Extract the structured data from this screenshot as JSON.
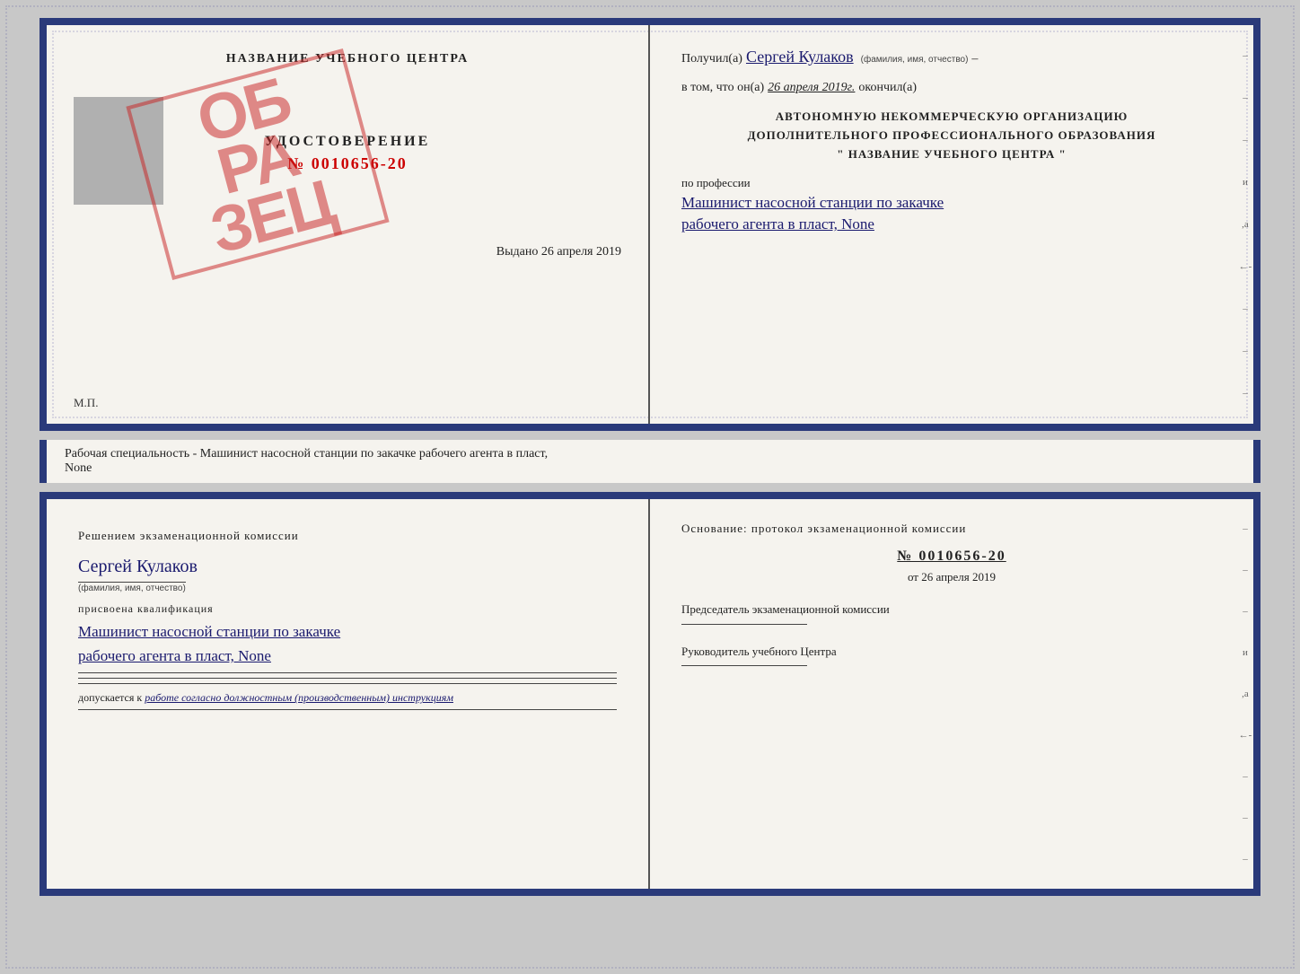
{
  "top_cert": {
    "left": {
      "title": "НАЗВАНИЕ УЧЕБНОГО ЦЕНТРА",
      "stamp_text": "ОБ\nРА\nЗЕЦ",
      "udost_label": "УДОСТОВЕРЕНИЕ",
      "udost_number": "№ 0010656-20",
      "vydano": "Выдано 26 апреля 2019",
      "mp": "М.П."
    },
    "right": {
      "poluchil_label": "Получил(а)",
      "poluchil_name": "Сергей Кулаков",
      "fio_label": "(фамилия, имя, отчество)",
      "vtom_label": "в том, что он(а)",
      "vtom_date": "26 апреля 2019г.",
      "okonchil": "окончил(а)",
      "org_line1": "АВТОНОМНУЮ НЕКОММЕРЧЕСКУЮ ОРГАНИЗАЦИЮ",
      "org_line2": "ДОПОЛНИТЕЛЬНОГО ПРОФЕССИОНАЛЬНОГО ОБРАЗОВАНИЯ",
      "org_line3": "\"   НАЗВАНИЕ УЧЕБНОГО ЦЕНТРА   \"",
      "po_professii": "по профессии",
      "profession_line1": "Машинист насосной станции по закачке",
      "profession_line2": "рабочего агента в пласт, None"
    }
  },
  "middle": {
    "text": "Рабочая специальность - Машинист насосной станции по закачке рабочего агента в пласт,",
    "text2": "None"
  },
  "bottom_cert": {
    "left": {
      "resheniem": "Решением экзаменационной комиссии",
      "name": "Сергей Кулаков",
      "fio_label": "(фамилия, имя, отчество)",
      "prisvoena": "присвоена квалификация",
      "profession_line1": "Машинист насосной станции по закачке",
      "profession_line2": "рабочего агента в пласт, None",
      "dopuskaetsya_prefix": "допускается к",
      "dopuskaetsya_text": "работе согласно должностным (производственным) инструкциям"
    },
    "right": {
      "osnov_title": "Основание: протокол экзаменационной комиссии",
      "protocol_number": "№ 0010656-20",
      "protocol_date_prefix": "от",
      "protocol_date": "26 апреля 2019",
      "pred_label": "Председатель экзаменационной комиссии",
      "ruk_label": "Руководитель учебного Центра"
    }
  }
}
